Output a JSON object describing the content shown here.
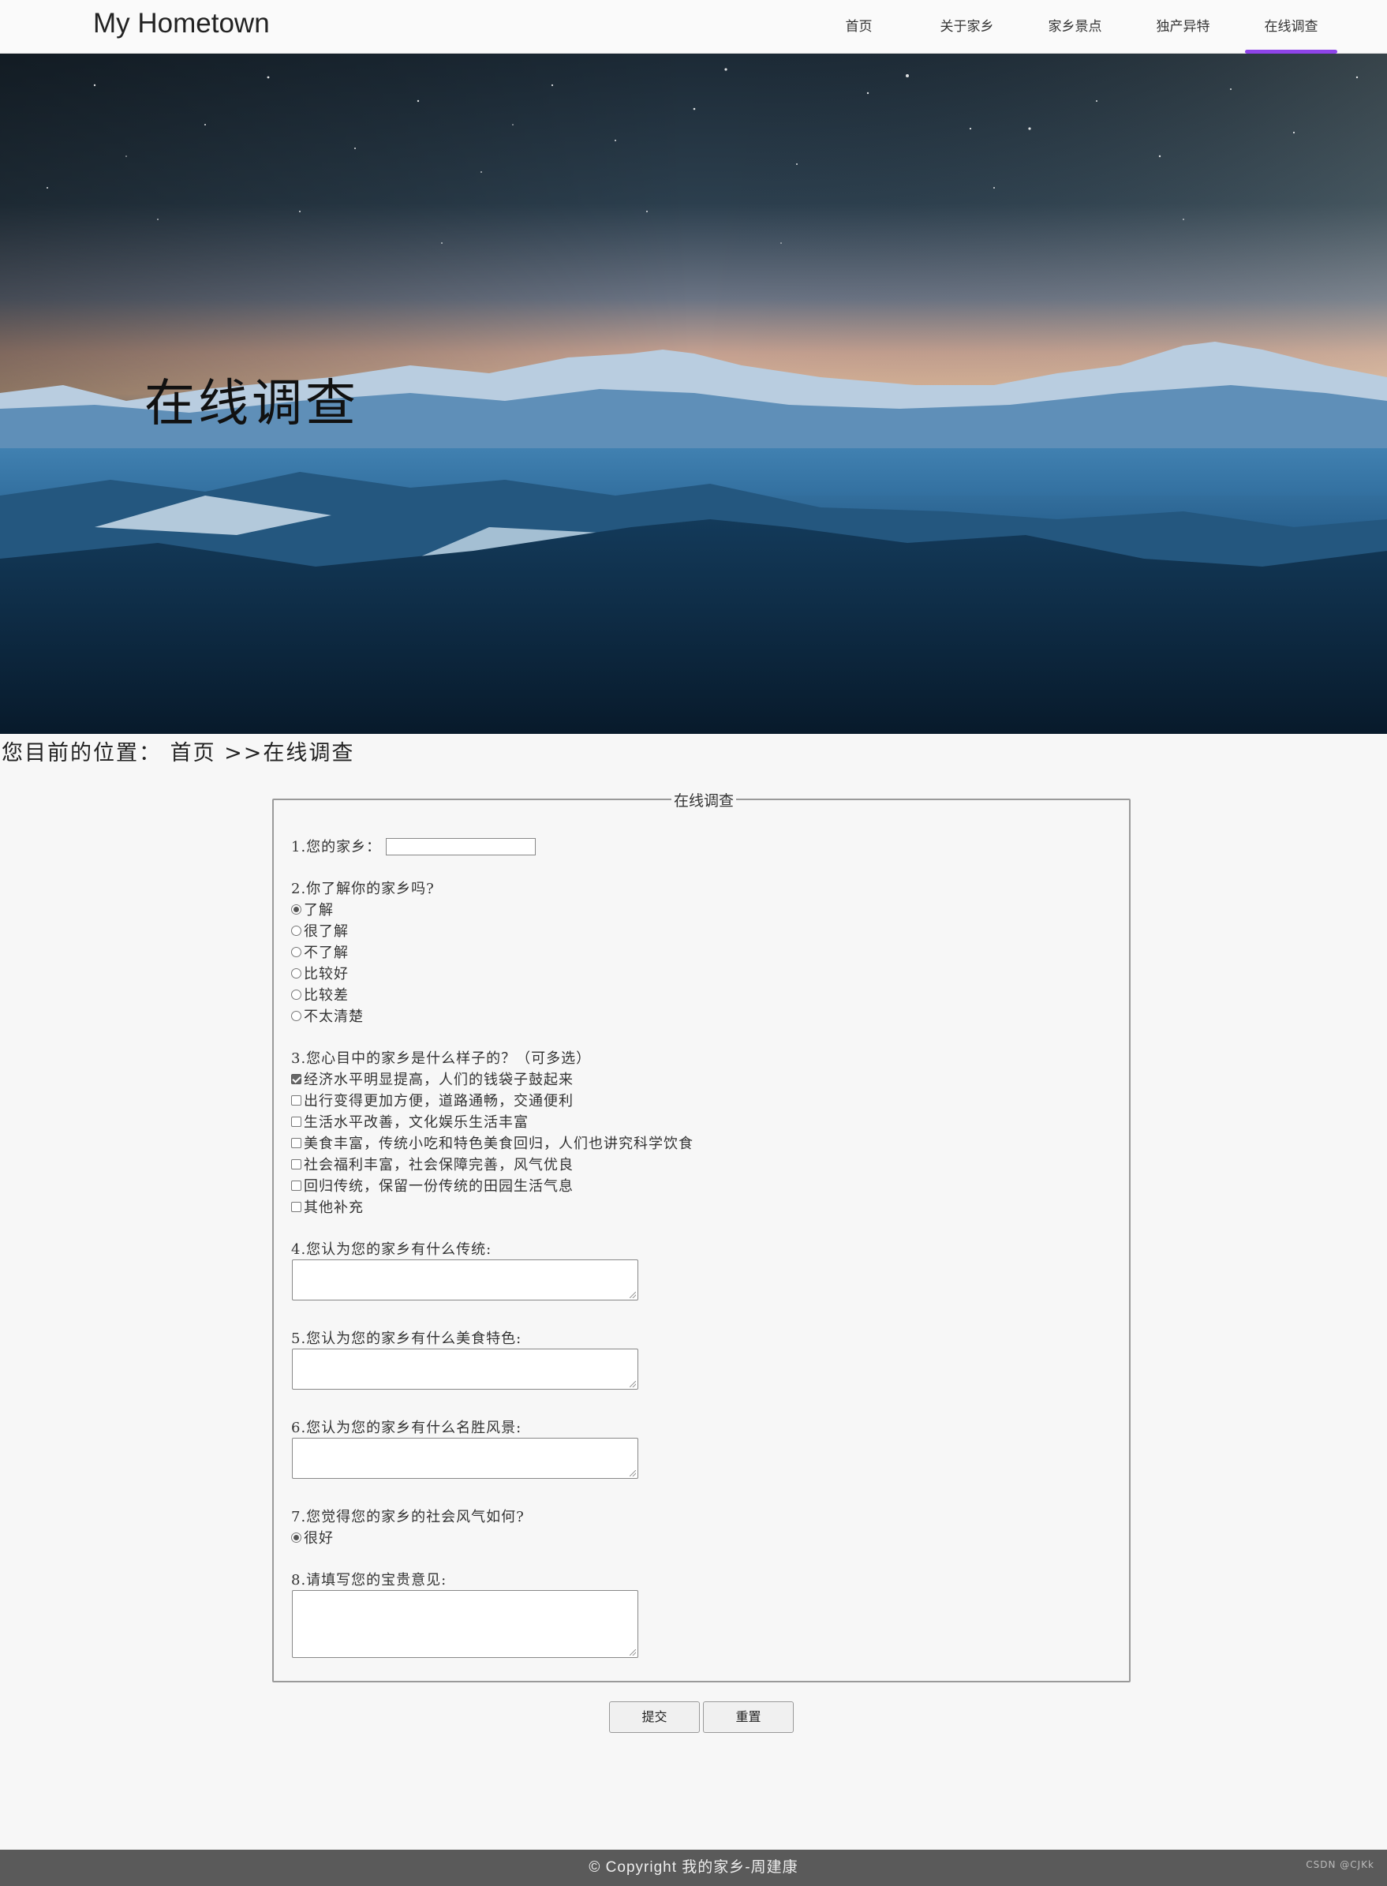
{
  "header": {
    "logo": "My Hometown",
    "nav": [
      {
        "label": "首页",
        "active": false
      },
      {
        "label": "关于家乡",
        "active": false
      },
      {
        "label": "家乡景点",
        "active": false
      },
      {
        "label": "独产异特",
        "active": false
      },
      {
        "label": "在线调查",
        "active": true
      }
    ],
    "accent_color": "#8e44e8"
  },
  "hero": {
    "title": "在线调查"
  },
  "breadcrumb": "您目前的位置： 首页 >>在线调查",
  "survey": {
    "legend": "在线调查",
    "q1": {
      "label": "1.您的家乡：",
      "value": ""
    },
    "q2": {
      "label": "2.你了解你的家乡吗?",
      "options": [
        "了解",
        "很了解",
        "不了解",
        "比较好",
        "比较差",
        "不太清楚"
      ],
      "selected_index": 0
    },
    "q3": {
      "label": "3.您心目中的家乡是什么样子的？（可多选）",
      "options": [
        "经济水平明显提高，人们的钱袋子鼓起来",
        "出行变得更加方便，道路通畅，交通便利",
        " 生活水平改善，文化娱乐生活丰富",
        " 美食丰富，传统小吃和特色美食回归，人们也讲究科学饮食",
        "社会福利丰富，社会保障完善，风气优良",
        "回归传统，保留一份传统的田园生活气息",
        " 其他补充"
      ],
      "checked": [
        true,
        false,
        false,
        false,
        false,
        false,
        false
      ]
    },
    "q4": {
      "label": "4.您认为您的家乡有什么传统:",
      "value": ""
    },
    "q5": {
      "label": "5.您认为您的家乡有什么美食特色:",
      "value": ""
    },
    "q6": {
      "label": "6.您认为您的家乡有什么名胜风景:",
      "value": ""
    },
    "q7": {
      "label": "7.您觉得您的家乡的社会风气如何?",
      "options": [
        "很好"
      ],
      "selected_index": 0
    },
    "q8": {
      "label": "8.请填写您的宝贵意见:",
      "value": ""
    }
  },
  "buttons": {
    "submit": "提交",
    "reset": "重置"
  },
  "footer": {
    "text": "© Copyright 我的家乡-周建康"
  },
  "watermark": "CSDN @CJKk"
}
